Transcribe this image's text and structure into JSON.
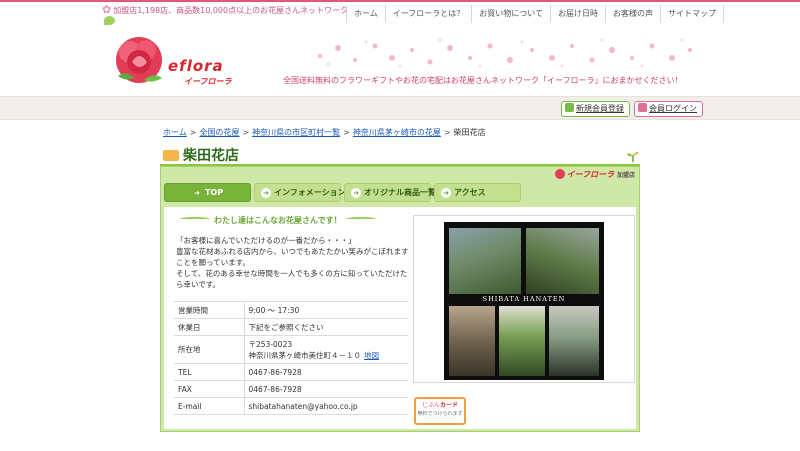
{
  "header": {
    "tagline": "加盟店1,198店、商品数10,000点以上のお花屋さんネットワーク",
    "nav": [
      "ホーム",
      "イーフローラとは？",
      "お買い物について",
      "お届け日時",
      "お客様の声",
      "サイトマップ"
    ],
    "logo_text": "eflora",
    "logo_kana": "イーフローラ",
    "site_description": "全国送料無料のフラワーギフトやお花の宅配はお花屋さんネットワーク「イーフローラ」におまかせください！"
  },
  "member": {
    "register_label": "新規会員登録",
    "login_label": "会員ログイン"
  },
  "breadcrumb": {
    "items": [
      "ホーム",
      "全国の花屋",
      "神奈川県の市区町村一覧",
      "神奈川県茅ヶ崎市の花屋"
    ],
    "current": "柴田花店",
    "separator": ">"
  },
  "shop": {
    "name": "柴田花店",
    "badge": "イーフローラ",
    "badge_suffix": "加盟店",
    "tabs": [
      "TOP",
      "インフォメーション",
      "オリジナル商品一覧",
      "アクセス"
    ],
    "catch": "わたし達はこんなお花屋さんです！",
    "intro": "「お客様に喜んでいただけるのが一番だから・・・」\n豊富な花材あふれる店内から、いつでもあたたかい笑みがこぼれますことを願っています。\nそして、花のある幸せな時間を一人でも多くの方に知っていただけたら幸いです。",
    "info": [
      {
        "label": "営業時間",
        "value": "9:00 〜 17:30"
      },
      {
        "label": "休業日",
        "value": "下記をご参照ください"
      },
      {
        "label": "所在地",
        "value": "〒253-0023",
        "value2": "神奈川県茅ヶ崎市美住町４－１０",
        "link": "地図"
      },
      {
        "label": "TEL",
        "value": "0467-86-7928"
      },
      {
        "label": "FAX",
        "value": "0467-86-7928"
      },
      {
        "label": "E-mail",
        "value": "shibatahanaten@yahoo.co.jp"
      }
    ],
    "photo_caption": "SHIBATA HANATEN",
    "card_banner_line1": "じぶん",
    "card_banner_line2": "カード",
    "card_banner_line3": "無料でつけられます"
  },
  "colors": {
    "brand_pink": "#e2567c",
    "brand_red": "#d8262d",
    "green_dark": "#2d6a19",
    "green_tab": "#7ab33a",
    "panel_green": "#cfe8a8",
    "link_blue": "#1a5bb8"
  }
}
